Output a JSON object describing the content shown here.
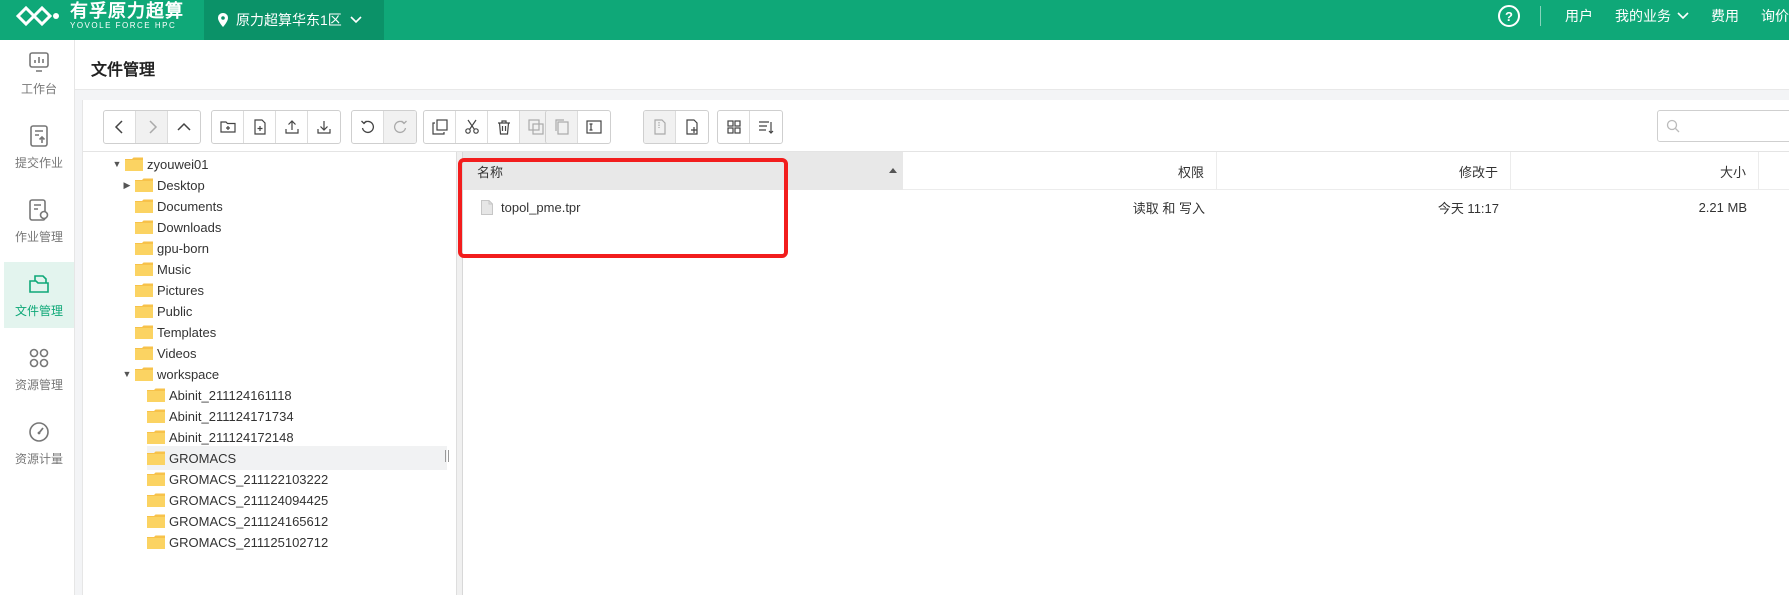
{
  "header": {
    "logo_cn": "有孚原力超算",
    "logo_en": "YOVOLE FORCE HPC",
    "region": "原力超算华东1区",
    "links": [
      "用户",
      "我的业务",
      "费用",
      "询价"
    ],
    "colors": {
      "brand": "#0fa878",
      "region_bg": "#0b9268",
      "highlight": "#f21d1d"
    }
  },
  "sidebar": {
    "items": [
      {
        "label": "工作台",
        "icon": "dashboard-icon"
      },
      {
        "label": "提交作业",
        "icon": "submit-job-icon"
      },
      {
        "label": "作业管理",
        "icon": "job-manage-icon"
      },
      {
        "label": "文件管理",
        "icon": "file-manage-icon"
      },
      {
        "label": "资源管理",
        "icon": "resource-grid-icon"
      },
      {
        "label": "资源计量",
        "icon": "gauge-icon"
      }
    ],
    "active_index": 3
  },
  "page": {
    "title": "文件管理"
  },
  "search": {
    "placeholder": ""
  },
  "tree": {
    "root": "zyouwei01",
    "children": [
      "Desktop",
      "Documents",
      "Downloads",
      "gpu-born",
      "Music",
      "Pictures",
      "Public",
      "Templates",
      "Videos",
      "workspace"
    ],
    "workspace_children": [
      "Abinit_211124161118",
      "Abinit_211124171734",
      "Abinit_211124172148",
      "GROMACS",
      "GROMACS_211122103222",
      "GROMACS_211124094425",
      "GROMACS_211124165612",
      "GROMACS_211125102712"
    ],
    "selected": "GROMACS"
  },
  "file_list": {
    "columns": {
      "name": "名称",
      "permission": "权限",
      "modified": "修改于",
      "size": "大小"
    },
    "rows": [
      {
        "name": "topol_pme.tpr",
        "permission": "读取 和 写入",
        "modified": "今天 11:17",
        "size": "2.21 MB"
      }
    ]
  }
}
